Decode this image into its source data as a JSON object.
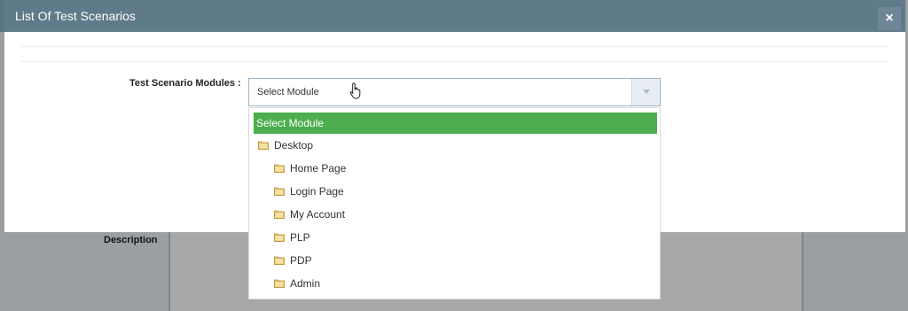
{
  "modal": {
    "title": "List Of Test Scenarios",
    "close_label": "×"
  },
  "form": {
    "module_label": "Test Scenario Modules :",
    "selected_value": "Select Module"
  },
  "dropdown": {
    "selected_option": "Select Module",
    "options": [
      {
        "label": "Desktop",
        "icon": "folder-icon",
        "level": 0
      },
      {
        "label": "Home Page",
        "icon": "folder-icon",
        "level": 1
      },
      {
        "label": "Login Page",
        "icon": "folder-icon",
        "level": 1
      },
      {
        "label": "My Account",
        "icon": "folder-icon",
        "level": 1
      },
      {
        "label": "PLP",
        "icon": "folder-icon",
        "level": 1
      },
      {
        "label": "PDP",
        "icon": "folder-icon",
        "level": 1
      },
      {
        "label": "Admin",
        "icon": "folder-icon",
        "level": 1
      }
    ],
    "highlight_color": "#4cae4c"
  },
  "background": {
    "description_label": "Description"
  },
  "colors": {
    "header": "#5f7b8a",
    "highlight": "#4cae4c"
  }
}
